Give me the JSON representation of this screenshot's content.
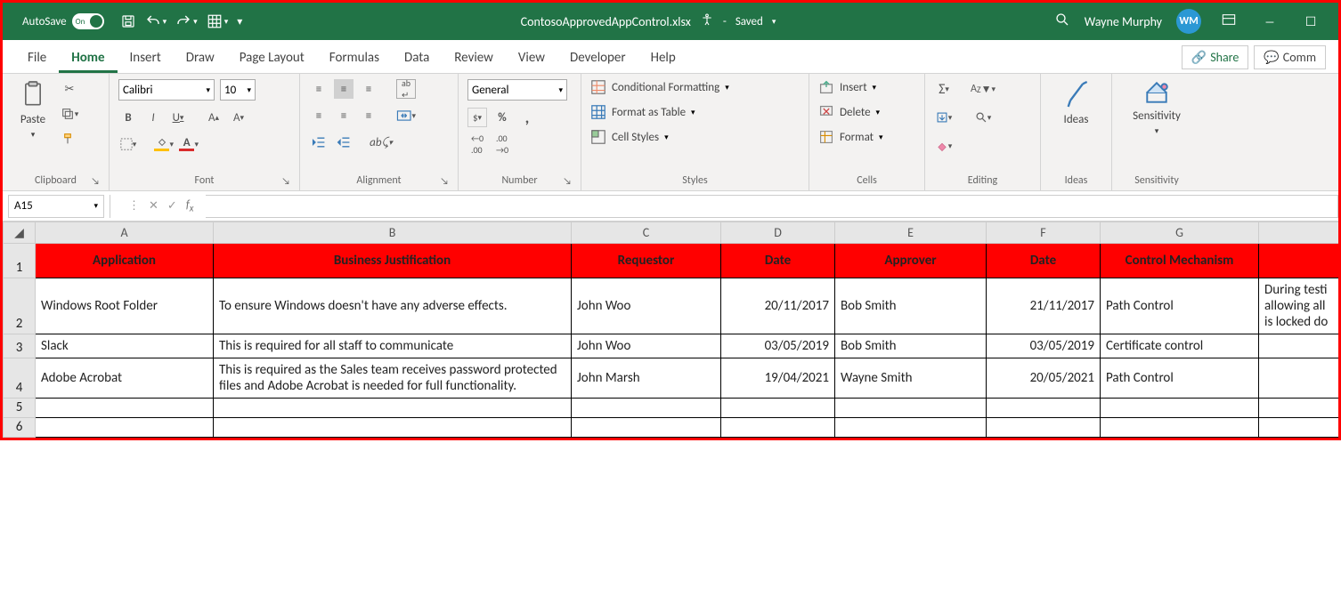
{
  "titlebar": {
    "autosave": "AutoSave",
    "autosave_state": "On",
    "filename": "ContosoApprovedAppControl.xlsx",
    "saved": "Saved",
    "user": "Wayne Murphy",
    "initials": "WM"
  },
  "menu": {
    "tabs": [
      "File",
      "Home",
      "Insert",
      "Draw",
      "Page Layout",
      "Formulas",
      "Data",
      "Review",
      "View",
      "Developer",
      "Help"
    ],
    "active": "Home",
    "share": "Share",
    "comments": "Comm"
  },
  "ribbon": {
    "clipboard": {
      "label": "Clipboard",
      "paste": "Paste"
    },
    "font": {
      "label": "Font",
      "name": "Calibri",
      "size": "10"
    },
    "alignment": {
      "label": "Alignment"
    },
    "number": {
      "label": "Number",
      "format": "General"
    },
    "styles": {
      "label": "Styles",
      "cond": "Conditional Formatting",
      "table": "Format as Table",
      "cell": "Cell Styles"
    },
    "cells": {
      "label": "Cells",
      "insert": "Insert",
      "delete": "Delete",
      "format": "Format"
    },
    "editing": {
      "label": "Editing"
    },
    "ideas": {
      "label": "Ideas",
      "btn": "Ideas"
    },
    "sensitivity": {
      "label": "Sensitivity",
      "btn": "Sensitivity"
    }
  },
  "namebox": "A15",
  "columns": [
    "A",
    "B",
    "C",
    "D",
    "E",
    "F",
    "G"
  ],
  "headers": [
    "Application",
    "Business Justification",
    "Requestor",
    "Date",
    "Approver",
    "Date",
    "Control Mechanism"
  ],
  "rows": [
    {
      "n": "2",
      "app": "Windows Root Folder",
      "just": "To ensure Windows doesn't have any adverse effects.",
      "req": "John Woo",
      "d1": "20/11/2017",
      "appr": "Bob Smith",
      "d2": "21/11/2017",
      "ctrl": "Path Control",
      "h": "During testi\nallowing all\nis locked do"
    },
    {
      "n": "3",
      "app": "Slack",
      "just": "This is required for all staff to communicate",
      "req": "John Woo",
      "d1": "03/05/2019",
      "appr": "Bob Smith",
      "d2": "03/05/2019",
      "ctrl": "Certificate control",
      "h": ""
    },
    {
      "n": "4",
      "app": "Adobe Acrobat",
      "just": "This is required as the Sales team receives password protected files and Adobe Acrobat is needed for full functionality.",
      "req": "John Marsh",
      "d1": "19/04/2021",
      "appr": "Wayne Smith",
      "d2": "20/05/2021",
      "ctrl": "Path Control",
      "h": ""
    }
  ],
  "empty_rows": [
    "5",
    "6"
  ]
}
